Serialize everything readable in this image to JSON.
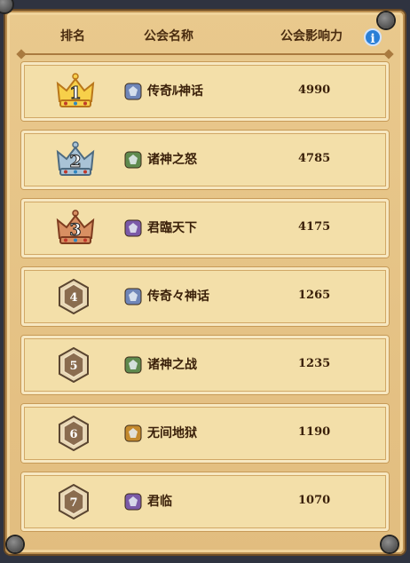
{
  "header": {
    "rank": "排名",
    "guild_name": "公会名称",
    "influence": "公会影响力",
    "info": "i"
  },
  "rows": [
    {
      "rank": "1",
      "name": "传奇ﾙ神话",
      "score": "4990",
      "crown": "gold",
      "emblem": "#6f86b8"
    },
    {
      "rank": "2",
      "name": "诸神之怒",
      "score": "4785",
      "crown": "silver",
      "emblem": "#5f8a4e"
    },
    {
      "rank": "3",
      "name": "君臨天下",
      "score": "4175",
      "crown": "bronze",
      "emblem": "#7b5aa8"
    },
    {
      "rank": "4",
      "name": "传奇々神话",
      "score": "1265",
      "crown": "none",
      "emblem": "#6f86b8"
    },
    {
      "rank": "5",
      "name": "诸神之战",
      "score": "1235",
      "crown": "none",
      "emblem": "#5f8a4e"
    },
    {
      "rank": "6",
      "name": "无间地狱",
      "score": "1190",
      "crown": "none",
      "emblem": "#c48a2e"
    },
    {
      "rank": "7",
      "name": "君临",
      "score": "1070",
      "crown": "none",
      "emblem": "#7b5aa8"
    }
  ]
}
